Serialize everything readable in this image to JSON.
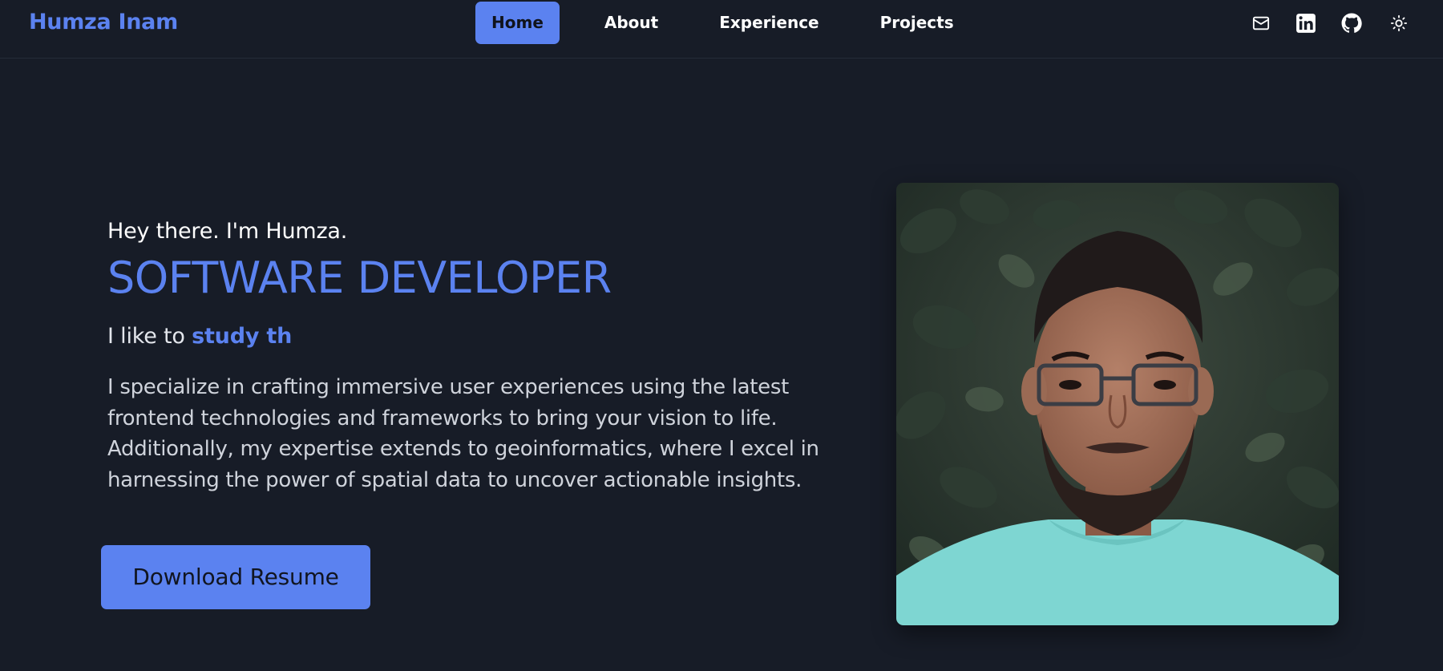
{
  "brand": "Humza Inam",
  "nav": {
    "links": [
      {
        "label": "Home",
        "active": true
      },
      {
        "label": "About",
        "active": false
      },
      {
        "label": "Experience",
        "active": false
      },
      {
        "label": "Projects",
        "active": false
      }
    ],
    "icons": [
      "mail-icon",
      "linkedin-icon",
      "github-icon",
      "theme-toggle-sun-icon"
    ]
  },
  "hero": {
    "greeting": "Hey there. I'm Humza.",
    "headline": "SOFTWARE DEVELOPER",
    "tagline_prefix": "I like to ",
    "tagline_typed": "study th",
    "bio": "I specialize in crafting immersive user experiences using the latest frontend technologies and frameworks to bring your vision to life. Additionally, my expertise extends to geoinformatics, where I excel in harnessing the power of spatial data to uncover actionable insights.",
    "button_label": "Download Resume"
  },
  "colors": {
    "background": "#171c27",
    "accent": "#5b82f0",
    "text": "#ffffff"
  }
}
